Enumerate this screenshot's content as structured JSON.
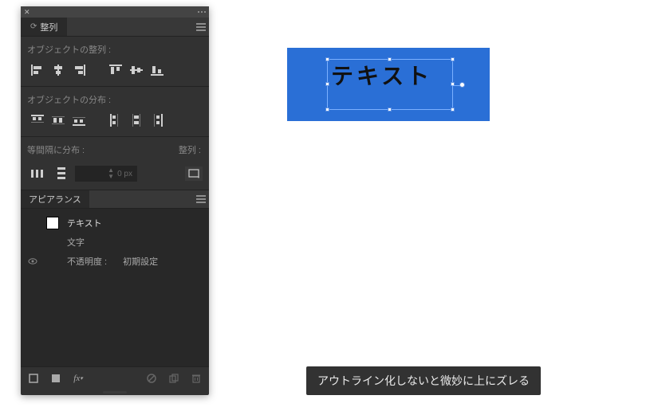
{
  "panel": {
    "tabs": {
      "align_label": "整列"
    },
    "align_section": {
      "label": "オブジェクトの整列 :",
      "icons": [
        "align-left",
        "align-h-center",
        "align-right",
        "align-top",
        "align-v-center",
        "align-bottom"
      ]
    },
    "distribute_section": {
      "label": "オブジェクトの分布 :",
      "icons": [
        "dist-top",
        "dist-v-center",
        "dist-bottom",
        "dist-left",
        "dist-h-center",
        "dist-right"
      ]
    },
    "equal_section": {
      "label": "等間隔に分布 :",
      "align_to_label": "整列 :",
      "spacing_value": "0 px",
      "icons": [
        "space-h",
        "space-v"
      ]
    },
    "appearance": {
      "tab_label": "アピアランス",
      "rows": [
        {
          "label": "テキスト",
          "kind": "text"
        },
        {
          "label": "文字",
          "kind": "char"
        },
        {
          "label": "不透明度 :",
          "value": "初期設定",
          "kind": "opacity"
        }
      ]
    },
    "footer_icons": [
      "stroke-none",
      "fill-solid",
      "fx",
      "clear",
      "duplicate",
      "trash"
    ]
  },
  "canvas": {
    "text": "テキスト",
    "box_color": "#2a6fd6"
  },
  "caption": {
    "text": "アウトライン化しないと微妙に上にズレる"
  }
}
